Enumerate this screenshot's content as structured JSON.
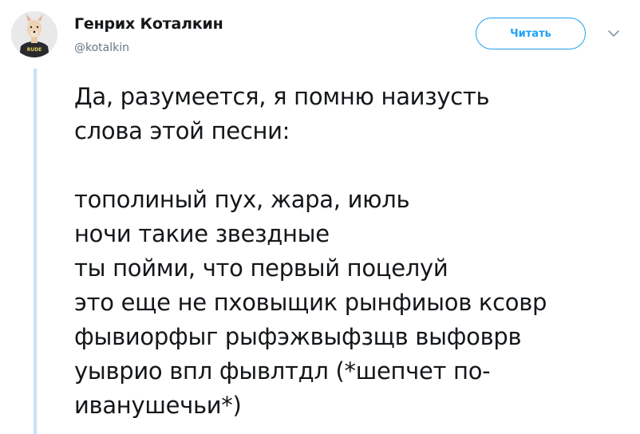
{
  "author": {
    "display_name": "Генрих Коталкин",
    "handle": "@kotalkin",
    "avatar_shirt_text": "RUDE"
  },
  "actions": {
    "follow_label": "Читать",
    "menu_icon": "chevron-down-icon"
  },
  "tweet": {
    "paragraph1": [
      "Да, разумеется, я помню наизусть",
      "слова этой песни:"
    ],
    "paragraph2": [
      "тополиный пух, жара, июль",
      "ночи такие звездные",
      "ты пойми, что первый поцелуй",
      "это еще не пховыщик рынфиыов ксовр",
      "фывиорфыг рыфэжвыфзщв выфоврв",
      "уыврио впл фывлтдл (*шепчет по-",
      "иванушечьи*)"
    ]
  },
  "colors": {
    "accent": "#1da1f2",
    "thread_line": "#c4e3f7",
    "text": "#14171a",
    "secondary_text": "#657786"
  }
}
